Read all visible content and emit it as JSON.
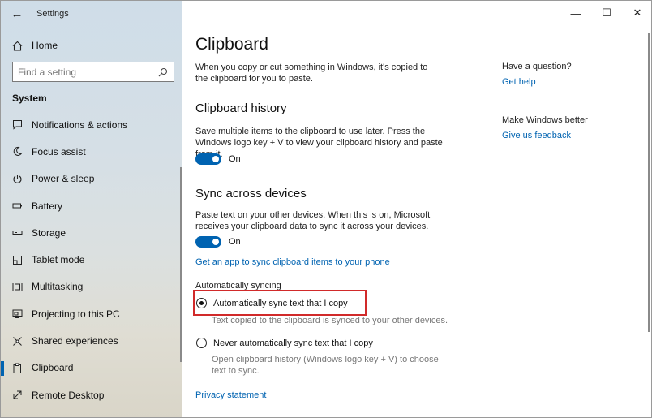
{
  "window": {
    "app_title": "Settings"
  },
  "sidebar": {
    "home_label": "Home",
    "search_placeholder": "Find a setting",
    "section_label": "System",
    "items": [
      {
        "label": "Notifications & actions",
        "icon": "notification-icon"
      },
      {
        "label": "Focus assist",
        "icon": "moon-icon"
      },
      {
        "label": "Power & sleep",
        "icon": "power-icon"
      },
      {
        "label": "Battery",
        "icon": "battery-icon"
      },
      {
        "label": "Storage",
        "icon": "storage-icon"
      },
      {
        "label": "Tablet mode",
        "icon": "tablet-mode-icon"
      },
      {
        "label": "Multitasking",
        "icon": "multitasking-icon"
      },
      {
        "label": "Projecting to this PC",
        "icon": "projecting-icon"
      },
      {
        "label": "Shared experiences",
        "icon": "shared-experiences-icon"
      },
      {
        "label": "Clipboard",
        "icon": "clipboard-icon",
        "active": true
      },
      {
        "label": "Remote Desktop",
        "icon": "remote-desktop-icon"
      }
    ]
  },
  "main": {
    "title": "Clipboard",
    "intro": "When you copy or cut something in Windows, it's copied to the clipboard for you to paste.",
    "history": {
      "heading": "Clipboard history",
      "desc": "Save multiple items to the clipboard to use later. Press the Windows logo key + V to view your clipboard history and paste from it.",
      "toggle_label": "On"
    },
    "sync": {
      "heading": "Sync across devices",
      "desc": "Paste text on your other devices. When this is on, Microsoft receives your clipboard data to sync it across your devices.",
      "toggle_label": "On",
      "app_link": "Get an app to sync clipboard items to your phone",
      "auto_label": "Automatically syncing",
      "option_auto": "Automatically sync text that I copy",
      "option_auto_desc": "Text copied to the clipboard is synced to your other devices.",
      "option_never": "Never automatically sync text that I copy",
      "option_never_desc": "Open clipboard history (Windows logo key + V) to choose text to sync."
    },
    "privacy_link": "Privacy statement"
  },
  "aside": {
    "question": "Have a question?",
    "help_link": "Get help",
    "better": "Make Windows better",
    "feedback_link": "Give us feedback"
  },
  "colors": {
    "accent": "#0063b1",
    "highlight": "#d12a2a"
  }
}
